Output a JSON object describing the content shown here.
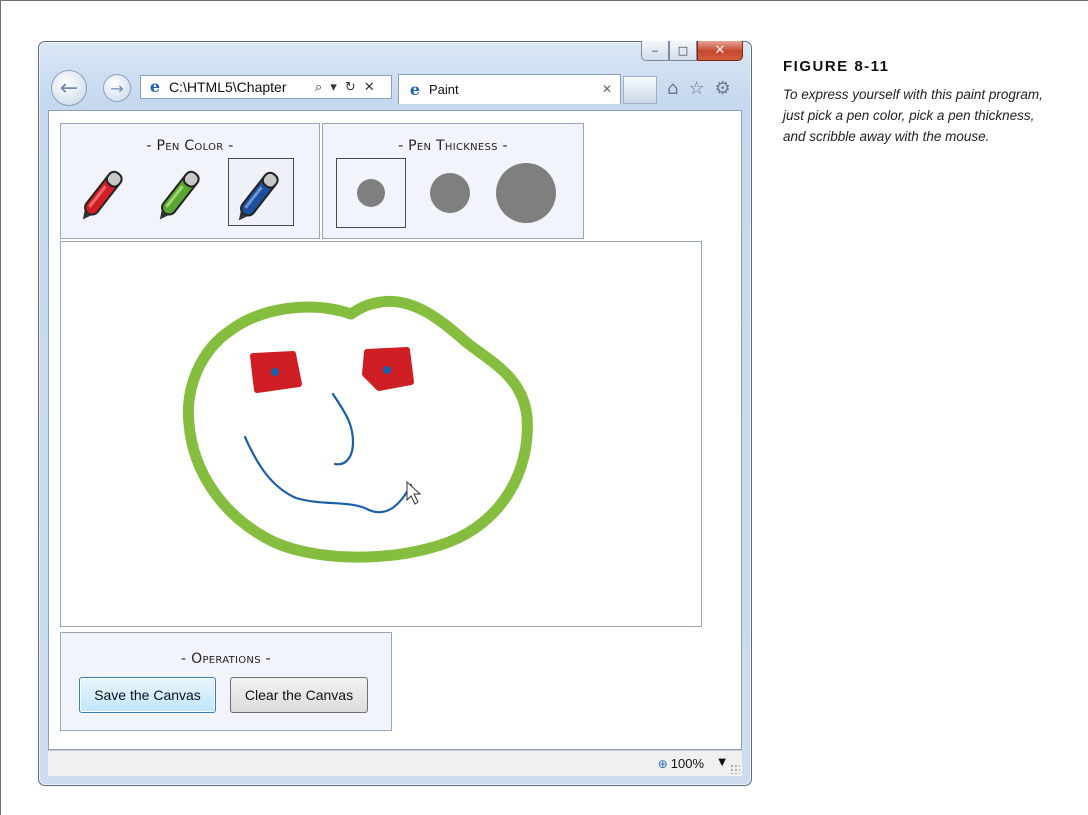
{
  "browser": {
    "address": "C:\\HTML5\\Chapter",
    "tab_title": "Paint",
    "zoom": "100%"
  },
  "app": {
    "pen_color_title": "- Pen Color -",
    "pen_thickness_title": "- Pen Thickness -",
    "operations_title": "- Operations -",
    "pens": [
      {
        "color": "red",
        "hex": "#d01f24",
        "selected": false
      },
      {
        "color": "green",
        "hex": "#5aa631",
        "selected": false
      },
      {
        "color": "blue",
        "hex": "#1c4f9c",
        "selected": true
      }
    ],
    "thickness_options": [
      "thin",
      "medium",
      "thick"
    ],
    "selected_thickness": "thin",
    "buttons": {
      "save": "Save the Canvas",
      "clear": "Clear the Canvas"
    }
  },
  "figure": {
    "label": "FIGURE 8-11",
    "caption": "To express yourself with this paint program, just pick a pen color, pick a pen thickness, and scribble away with the mouse."
  },
  "colors": {
    "stroke_green": "#85bd3f",
    "stroke_red": "#d01f24",
    "stroke_blue": "#1b5fa8"
  }
}
